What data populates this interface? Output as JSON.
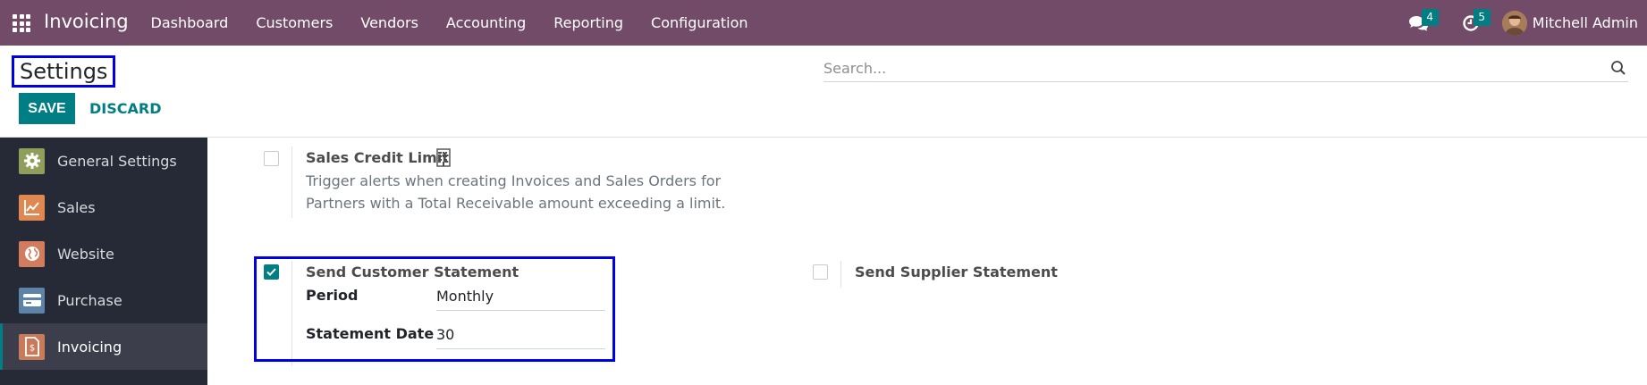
{
  "navbar": {
    "app_name": "Invoicing",
    "menu": [
      "Dashboard",
      "Customers",
      "Vendors",
      "Accounting",
      "Reporting",
      "Configuration"
    ],
    "messages_count": "4",
    "activities_count": "5",
    "user_name": "Mitchell Admin",
    "color": "#714b67"
  },
  "control_panel": {
    "title": "Settings",
    "save_label": "SAVE",
    "discard_label": "DISCARD",
    "search_placeholder": "Search..."
  },
  "sidebar": {
    "items": [
      {
        "label": "General Settings",
        "icon": "gear-icon",
        "color": "#8f9e5a"
      },
      {
        "label": "Sales",
        "icon": "chart-icon",
        "color": "#e08850"
      },
      {
        "label": "Website",
        "icon": "globe-icon",
        "color": "#d27c5e"
      },
      {
        "label": "Purchase",
        "icon": "card-icon",
        "color": "#5e83a8"
      },
      {
        "label": "Invoicing",
        "icon": "invoice-icon",
        "color": "#c97a5a",
        "active": true
      }
    ]
  },
  "settings": {
    "credit_limit": {
      "title": "Sales Credit Limit",
      "description": "Trigger alerts when creating Invoices and Sales Orders for Partners with a Total Receivable amount exceeding a limit.",
      "checked": false
    },
    "customer_statement": {
      "title": "Send Customer Statement",
      "checked": true,
      "period_label": "Period",
      "period_value": "Monthly",
      "date_label": "Statement Date",
      "date_value": "30"
    },
    "supplier_statement": {
      "title": "Send Supplier Statement",
      "checked": false
    }
  },
  "accent_color": "#017e84"
}
